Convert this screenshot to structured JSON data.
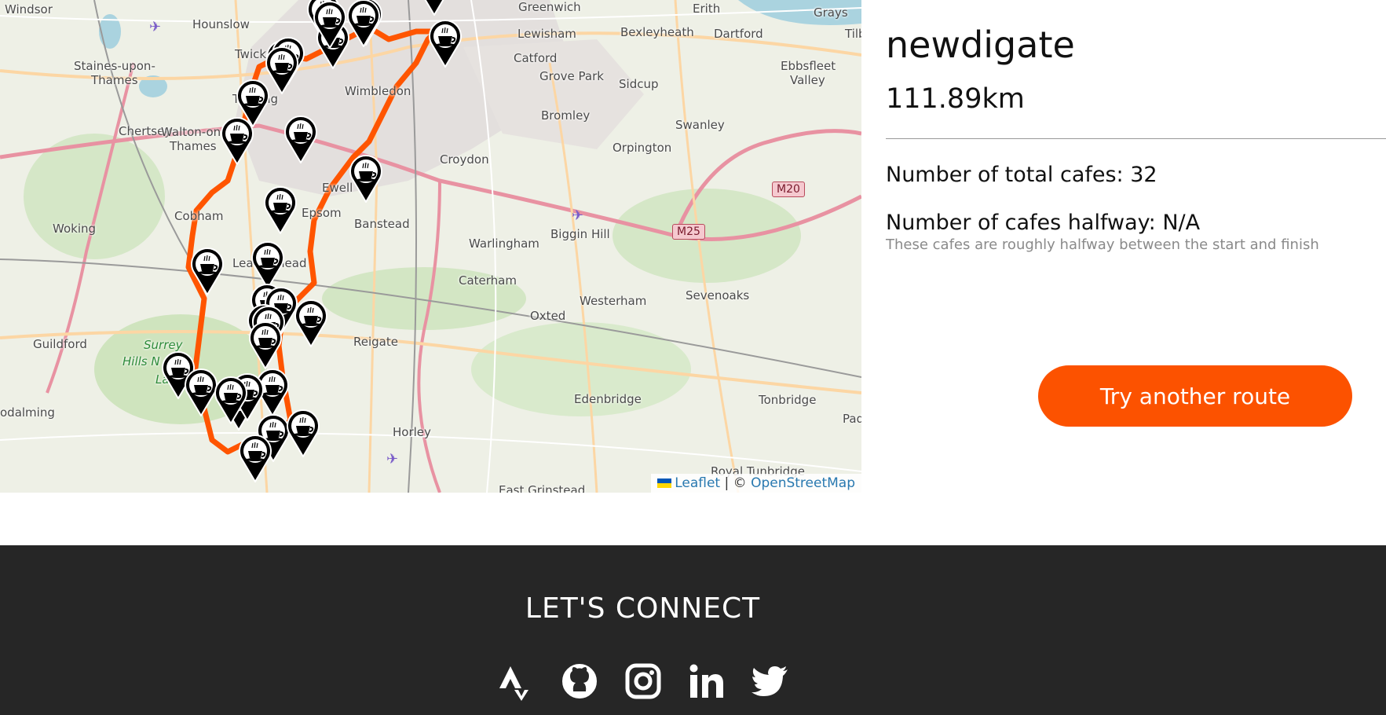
{
  "map": {
    "places": [
      {
        "name": "Windsor"
      },
      {
        "name": "Hounslow"
      },
      {
        "name": "Greenwich"
      },
      {
        "name": "Erith"
      },
      {
        "name": "Grays"
      },
      {
        "name": "Tilb"
      },
      {
        "name": "Lewisham"
      },
      {
        "name": "Bexleyheath"
      },
      {
        "name": "Dartford"
      },
      {
        "name": "Ebbsfleet"
      },
      {
        "name": "Valley"
      },
      {
        "name": "Staines-upon-"
      },
      {
        "name": "Thames"
      },
      {
        "name": "Twick"
      },
      {
        "name": "Tedding"
      },
      {
        "name": "Wimbledon"
      },
      {
        "name": "Catford"
      },
      {
        "name": "Grove Park"
      },
      {
        "name": "Sidcup"
      },
      {
        "name": "Bromley"
      },
      {
        "name": "Swanley"
      },
      {
        "name": "Chertsey"
      },
      {
        "name": "Walton-on-"
      },
      {
        "name": "Thames"
      },
      {
        "name": "Orpington"
      },
      {
        "name": "Croydon"
      },
      {
        "name": "Ewell"
      },
      {
        "name": "Epsom"
      },
      {
        "name": "Cobham"
      },
      {
        "name": "Woking"
      },
      {
        "name": "Banstead"
      },
      {
        "name": "Warlingham"
      },
      {
        "name": "Biggin Hill"
      },
      {
        "name": "Leatherhead"
      },
      {
        "name": "Caterham"
      },
      {
        "name": "Oxted"
      },
      {
        "name": "Westerham"
      },
      {
        "name": "Sevenoaks"
      },
      {
        "name": "Guildford"
      },
      {
        "name": "Reigate"
      },
      {
        "name": "Edenbridge"
      },
      {
        "name": "Tonbridge"
      },
      {
        "name": "odalming"
      },
      {
        "name": "Horley"
      },
      {
        "name": "Pad"
      },
      {
        "name": "Royal Tunbridge"
      },
      {
        "name": "East Grinstead"
      },
      {
        "name": "Surrey"
      },
      {
        "name": "Hills N"
      },
      {
        "name": "Lands"
      }
    ],
    "roads": [
      "M20",
      "M25"
    ],
    "attribution": {
      "leaflet": "Leaflet",
      "separator": "| ©",
      "osm": "OpenStreetMap"
    },
    "marker_icon": "coffee-cup-icon",
    "route_color": "#ff5500"
  },
  "route": {
    "name": "newdigate",
    "distance": "111.89km",
    "total_cafes": "Number of total cafes: 32",
    "halfway_cafes": "Number of cafes halfway: N/A",
    "halfway_note": "These cafes are roughly halfway between the start and finish"
  },
  "actions": {
    "try_another": "Try another route"
  },
  "footer": {
    "heading": "LET'S CONNECT",
    "icons": [
      "strava-icon",
      "github-icon",
      "instagram-icon",
      "linkedin-icon",
      "twitter-icon"
    ]
  },
  "colors": {
    "accent": "#fc5200",
    "footer_bg": "#262626"
  }
}
